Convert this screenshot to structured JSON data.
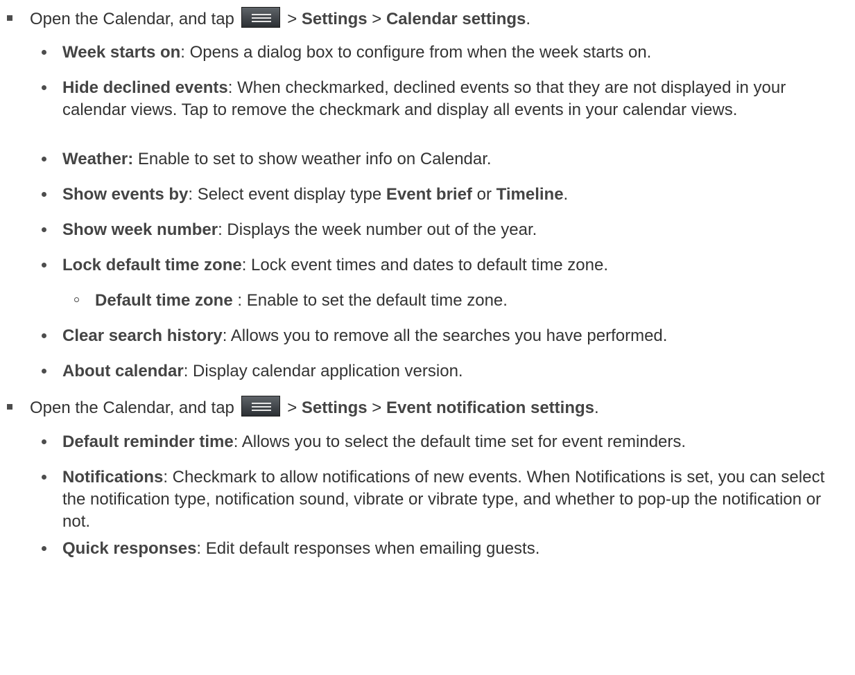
{
  "section1": {
    "intro": {
      "pre": "Open the Calendar, and tap",
      "sep1": " > ",
      "settings": "Settings",
      "sep2": " > ",
      "target": "Calendar settings",
      "end": "."
    },
    "items": [
      {
        "term": "Week starts on",
        "desc": ": Opens a dialog box to configure from when the week starts on."
      },
      {
        "term": "Hide declined events",
        "desc": ": When checkmarked, declined events so that they are not displayed in your calendar views. Tap to remove the checkmark and display all events in your calendar views."
      },
      {
        "term": "Weather:",
        "desc": " Enable to set to show weather info on Calendar."
      },
      {
        "term": "Show events by",
        "desc": ": Select event display type ",
        "opt1": "Event brief",
        "or": " or ",
        "opt2": "Timeline",
        "end": "."
      },
      {
        "term": "Show week number",
        "desc": ": Displays the week number out of the year."
      },
      {
        "term": "Lock default time zone",
        "desc": ": Lock event times and dates to default time zone."
      },
      {
        "term": "Clear search history",
        "desc": ": Allows you to remove all the searches you have performed."
      },
      {
        "term": "About calendar",
        "desc": ": Display calendar application version."
      }
    ],
    "subitem": {
      "term": "Default time zone",
      "desc": " : Enable to set the default time zone."
    }
  },
  "section2": {
    "intro": {
      "pre": "Open the Calendar, and tap",
      "sep1": " > ",
      "settings": "Settings",
      "sep2": " > ",
      "target": "Event notification settings",
      "end": "."
    },
    "items": [
      {
        "term": "Default reminder time",
        "desc": ": Allows you to select the default time set for event reminders."
      },
      {
        "term": "Notifications",
        "desc": ": Checkmark to allow notifications of new events. When Notifications is set, you can select the notification type, notification sound, vibrate or vibrate type, and whether to pop-up the notification or not."
      },
      {
        "term": "Quick responses",
        "desc": ": Edit default responses when emailing guests."
      }
    ]
  },
  "icons": {
    "menu": "menu-icon"
  }
}
